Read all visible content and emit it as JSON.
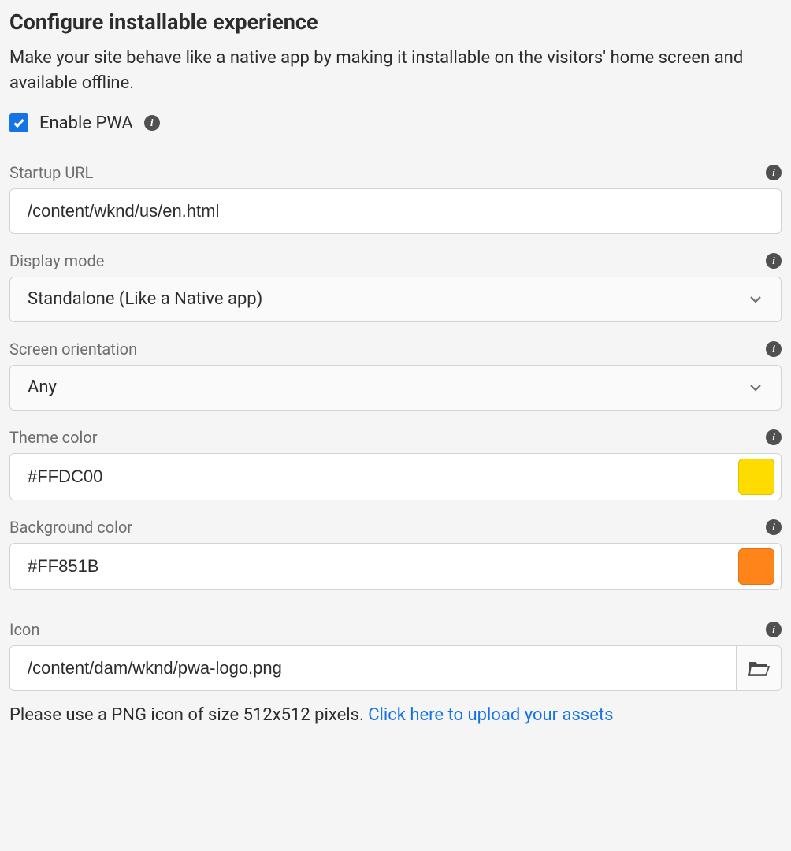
{
  "heading": "Configure installable experience",
  "description": "Make your site behave like a native app by making it installable on the visitors' home screen and available offline.",
  "enable": {
    "label": "Enable PWA",
    "checked": true
  },
  "fields": {
    "startup_url": {
      "label": "Startup URL",
      "value": "/content/wknd/us/en.html"
    },
    "display_mode": {
      "label": "Display mode",
      "value": "Standalone (Like a Native app)"
    },
    "screen_orientation": {
      "label": "Screen orientation",
      "value": "Any"
    },
    "theme_color": {
      "label": "Theme color",
      "value": "#FFDC00",
      "swatch": "#FFDC00"
    },
    "background_color": {
      "label": "Background color",
      "value": "#FF851B",
      "swatch": "#FF851B"
    },
    "icon": {
      "label": "Icon",
      "value": "/content/dam/wknd/pwa-logo.png"
    }
  },
  "helper": {
    "prefix": "Please use a PNG icon of size 512x512 pixels. ",
    "link": "Click here to upload your assets"
  }
}
